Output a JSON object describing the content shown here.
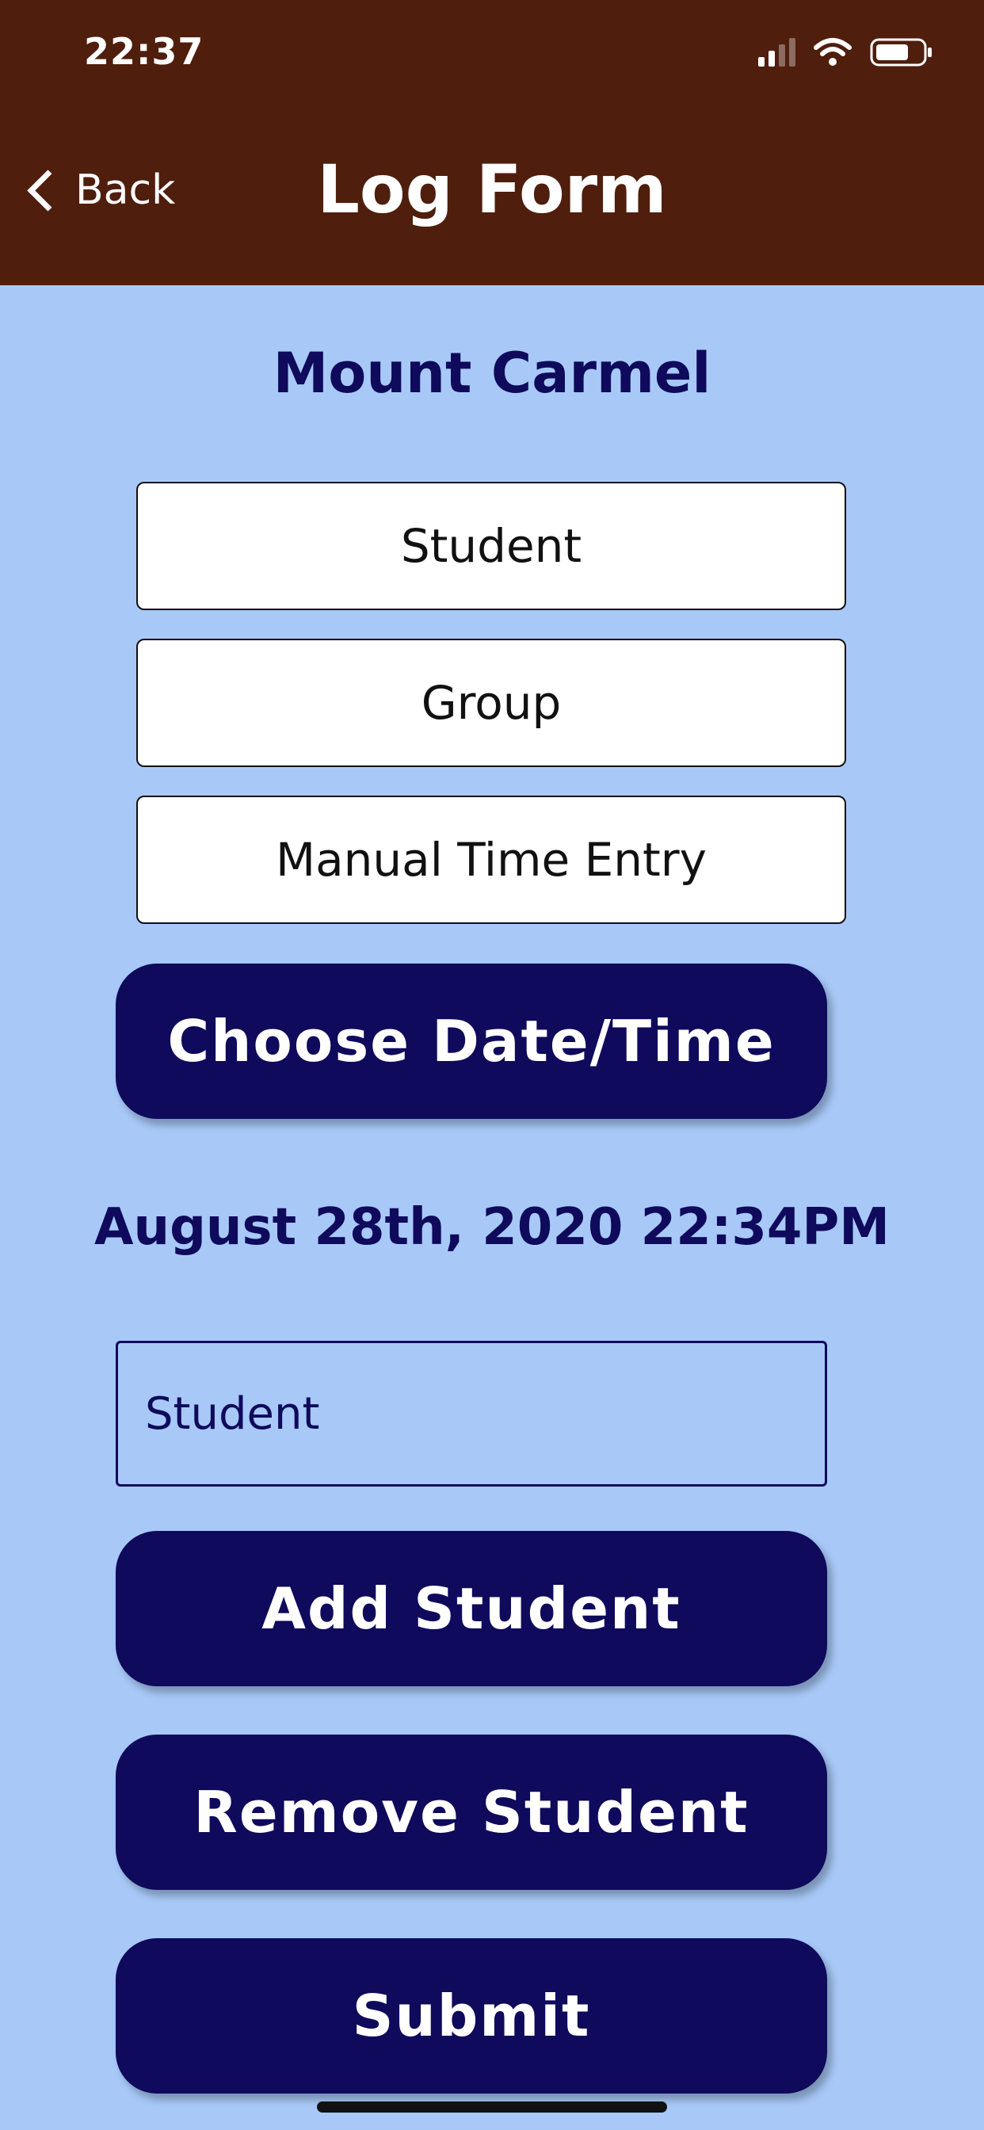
{
  "status_bar": {
    "time": "22:37"
  },
  "nav": {
    "back_label": "Back",
    "title": "Log Form"
  },
  "org_title": "Mount Carmel",
  "segments": {
    "student": "Student",
    "group": "Group",
    "manual": "Manual Time Entry"
  },
  "buttons": {
    "choose_date": "Choose Date/Time",
    "add_student": "Add Student",
    "remove_student": "Remove Student",
    "submit": "Submit"
  },
  "selected_datetime": "August 28th, 2020 22:34PM",
  "student_field": {
    "placeholder": "Student"
  },
  "colors": {
    "header": "#4f1e0d",
    "background": "#a8c9f8",
    "accent": "#0f0a5c"
  },
  "icons": [
    "signal-icon",
    "wifi-icon",
    "battery-icon",
    "back-chevron-icon"
  ]
}
